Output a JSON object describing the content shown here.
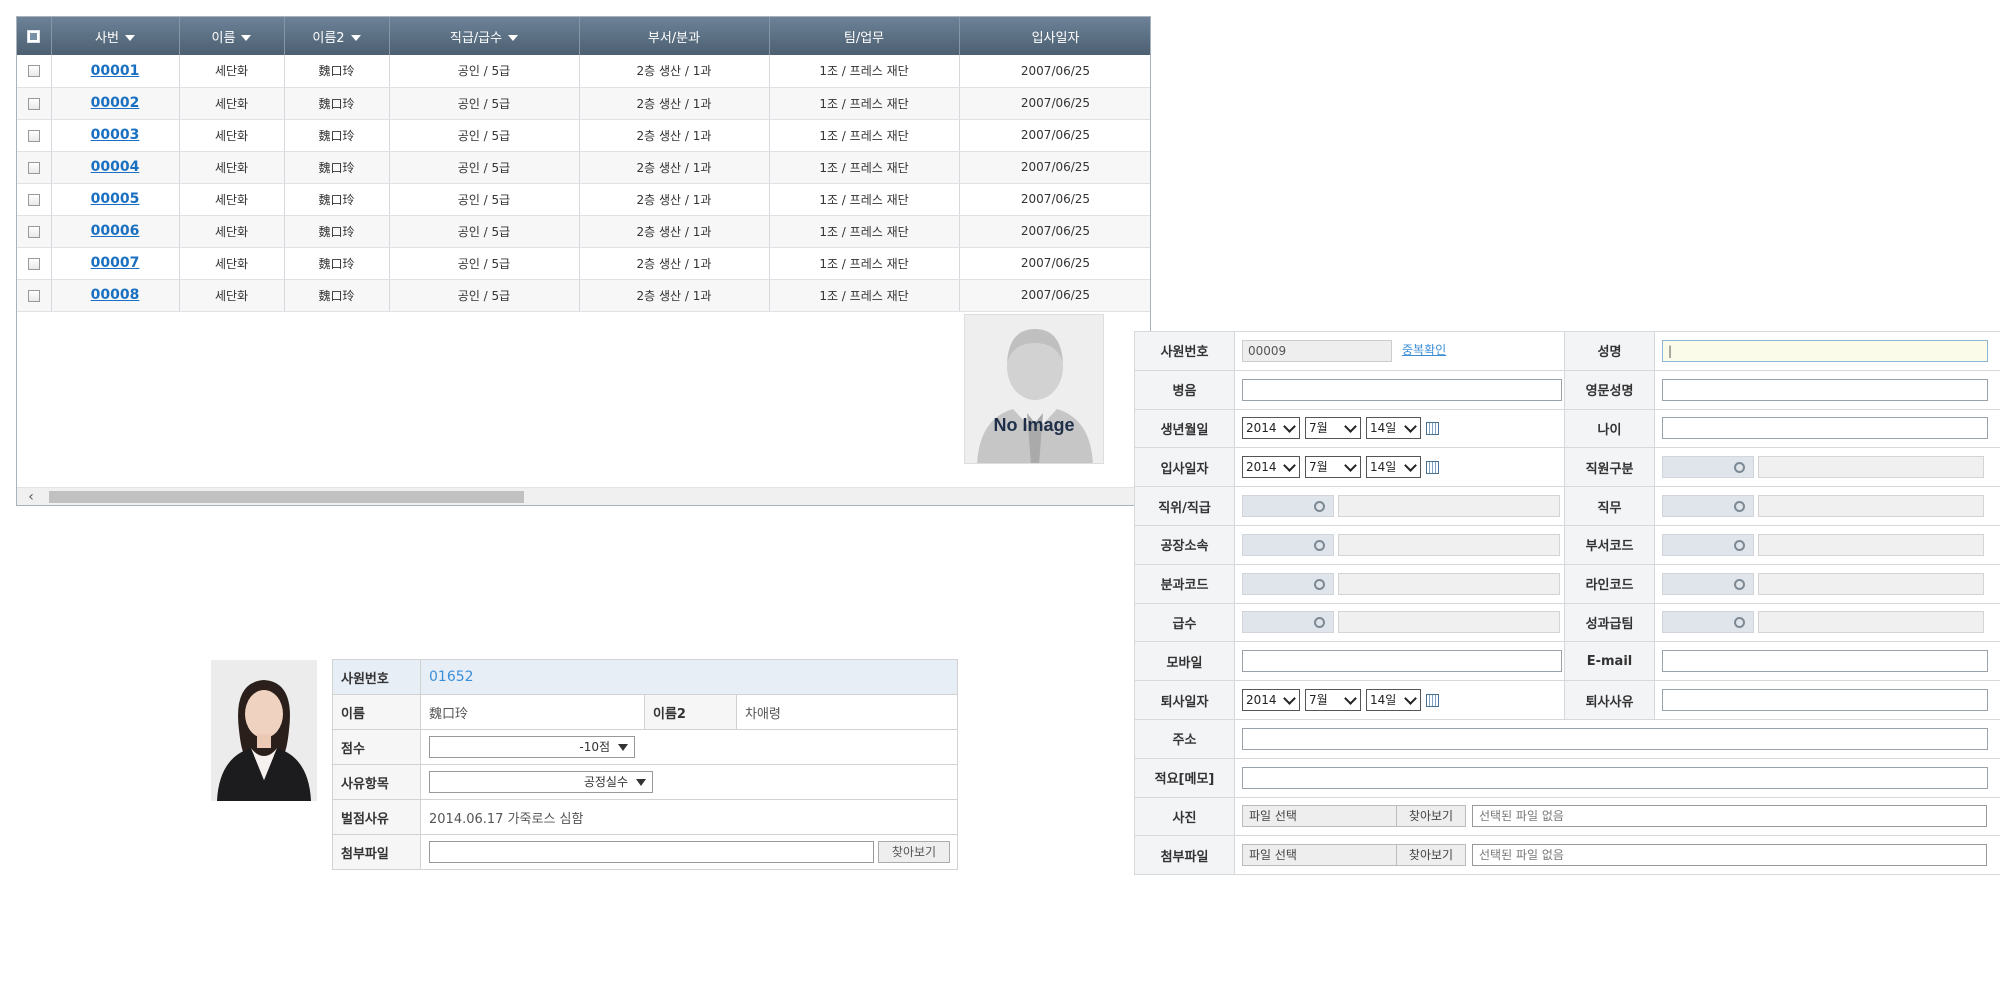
{
  "grid": {
    "columns": [
      "사번",
      "이름",
      "이름2",
      "직급/급수",
      "부서/분과",
      "팀/업무",
      "입사일자"
    ],
    "rows": [
      {
        "emp_no": "00001",
        "name": "세단화",
        "name2": "魏口玲",
        "grade": "공인 / 5급",
        "dept": "2층 생산 / 1과",
        "team": "1조 / 프레스 재단",
        "hire_date": "2007/06/25"
      },
      {
        "emp_no": "00002",
        "name": "세단화",
        "name2": "魏口玲",
        "grade": "공인 / 5급",
        "dept": "2층 생산 / 1과",
        "team": "1조 / 프레스 재단",
        "hire_date": "2007/06/25"
      },
      {
        "emp_no": "00003",
        "name": "세단화",
        "name2": "魏口玲",
        "grade": "공인 / 5급",
        "dept": "2층 생산 / 1과",
        "team": "1조 / 프레스 재단",
        "hire_date": "2007/06/25"
      },
      {
        "emp_no": "00004",
        "name": "세단화",
        "name2": "魏口玲",
        "grade": "공인 / 5급",
        "dept": "2층 생산 / 1과",
        "team": "1조 / 프레스 재단",
        "hire_date": "2007/06/25"
      },
      {
        "emp_no": "00005",
        "name": "세단화",
        "name2": "魏口玲",
        "grade": "공인 / 5급",
        "dept": "2층 생산 / 1과",
        "team": "1조 / 프레스 재단",
        "hire_date": "2007/06/25"
      },
      {
        "emp_no": "00006",
        "name": "세단화",
        "name2": "魏口玲",
        "grade": "공인 / 5급",
        "dept": "2층 생산 / 1과",
        "team": "1조 / 프레스 재단",
        "hire_date": "2007/06/25"
      },
      {
        "emp_no": "00007",
        "name": "세단화",
        "name2": "魏口玲",
        "grade": "공인 / 5급",
        "dept": "2층 생산 / 1과",
        "team": "1조 / 프레스 재단",
        "hire_date": "2007/06/25"
      },
      {
        "emp_no": "00008",
        "name": "세단화",
        "name2": "魏口玲",
        "grade": "공인 / 5급",
        "dept": "2층 생산 / 1과",
        "team": "1조 / 프레스 재단",
        "hire_date": "2007/06/25"
      }
    ],
    "no_image_text": "No Image"
  },
  "penalty": {
    "emp_no_label": "사원번호",
    "emp_no": "01652",
    "name_label": "이름",
    "name": "魏口玲",
    "name2_label": "이름2",
    "name2": "차애령",
    "score_label": "점수",
    "score": "-10점",
    "reason_item_label": "사유항목",
    "reason_item": "공정실수",
    "reason_label": "벌점사유",
    "reason": "2014.06.17 가죽로스 심함",
    "attach_label": "첨부파일",
    "browse": "찾아보기"
  },
  "form": {
    "emp_no_label": "사원번호",
    "emp_no": "00009",
    "dup_check": "중복확인",
    "name_label": "성명",
    "name_value": "|",
    "pinyin_label": "병음",
    "eng_name_label": "영문성명",
    "birth_label": "생년월일",
    "age_label": "나이",
    "hire_label": "입사일자",
    "emp_type_label": "직원구분",
    "position_label": "직위/직급",
    "duty_label": "직무",
    "factory_label": "공장소속",
    "dept_code_label": "부서코드",
    "section_code_label": "분과코드",
    "line_code_label": "라인코드",
    "grade_label": "급수",
    "perf_team_label": "성과급팀",
    "mobile_label": "모바일",
    "email_label": "E-mail",
    "resign_label": "퇴사일자",
    "resign_reason_label": "퇴사사유",
    "address_label": "주소",
    "memo_label": "적요[메모]",
    "photo_label": "사진",
    "attach_label": "첨부파일",
    "date_year": "2014",
    "date_month": "7월",
    "date_day": "14일",
    "file_select": "파일 선택",
    "file_browse": "찾아보기",
    "no_file": "선택된 파일 없음"
  }
}
